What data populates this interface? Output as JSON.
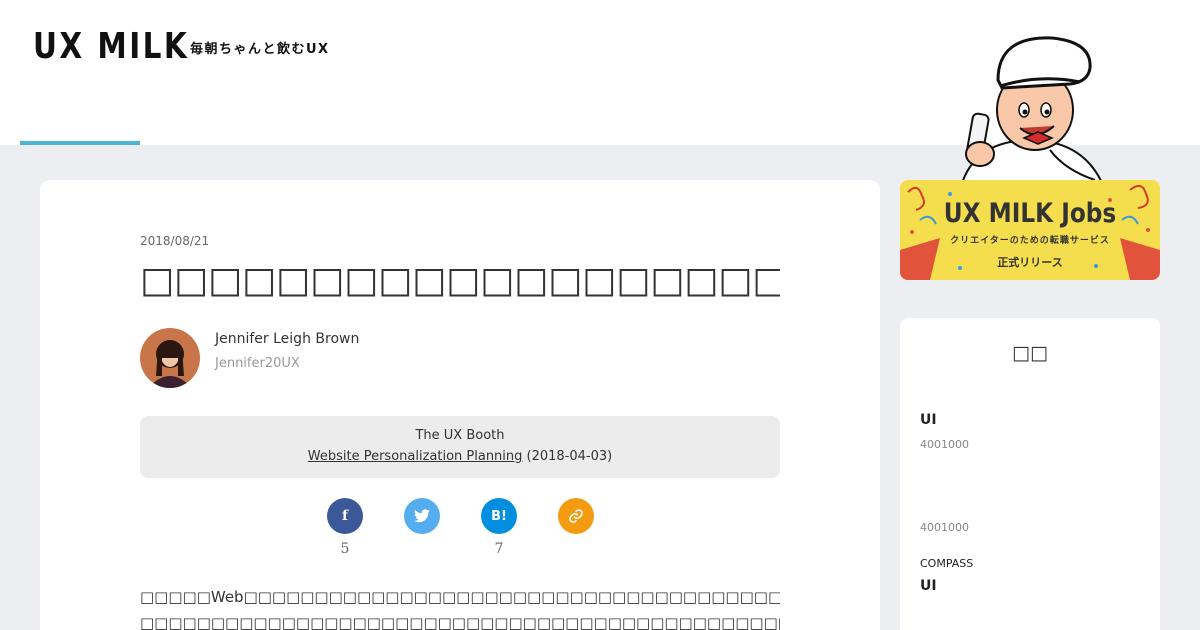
{
  "header": {
    "logo": "UX MILK",
    "tagline": "毎朝ちゃんと飲むUX"
  },
  "article": {
    "date": "2018/08/21",
    "title": "□□□□□□□□□□□□□□□□□□□□□□□□□□",
    "author": {
      "name": "Jennifer Leigh Brown",
      "handle": "Jennifer20UX"
    },
    "source": {
      "publication": "The UX Booth",
      "link_text": "Website Personalization Planning",
      "date_text": " (2018-04-03)"
    },
    "share": {
      "facebook_count": "5",
      "hatena_count": "7"
    },
    "body_lines": [
      "□□□□□Web□□□□□□□□□□□□□□□□□□□□□□□□□□□□□□□□□□□□□□□□□□□□□□□□□□□□□□□□□□□□□□□",
      "□□□□□□□□□□□□□□□□□□□□□□□□□□□□□□□□□□□□□□□□□□□□□□□□□□□□□□□□□□□□□□□□□□□□□□"
    ]
  },
  "banner": {
    "title": "UX MILK Jobs",
    "subtitle": "クリエイターのための転職サービス",
    "release": "正式リリース"
  },
  "sidebar": {
    "heading": "□□",
    "item1_label": "UI",
    "item1_meta": "4001000",
    "item2_meta": "4001000",
    "item3_small": "COMPASS",
    "item3_label": "UI"
  },
  "colors": {
    "accent": "#4fb3d6",
    "facebook": "#3b5998",
    "twitter": "#55acee",
    "hatena": "#008fde",
    "link": "#f39c12",
    "banner_yellow": "#f4de4d"
  },
  "icons": {
    "facebook": "facebook-icon",
    "twitter": "twitter-icon",
    "hatena": "hatena-bookmark-icon",
    "link": "link-icon"
  }
}
